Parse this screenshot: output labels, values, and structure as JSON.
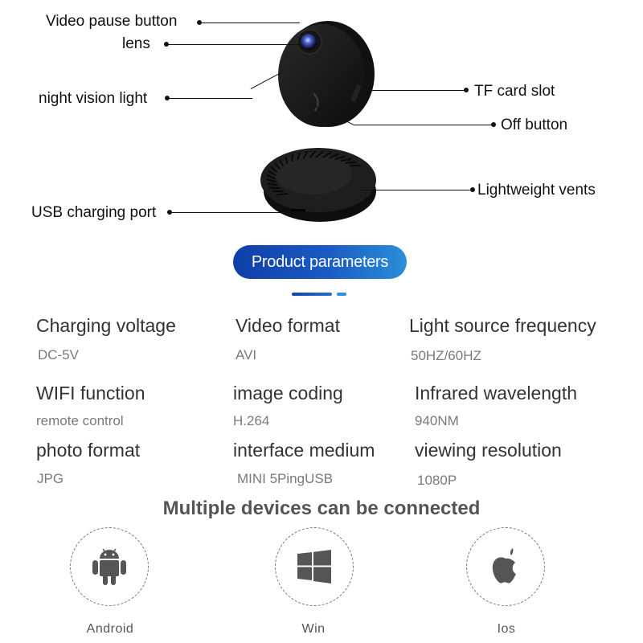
{
  "callouts": {
    "video_pause_button": "Video pause button",
    "lens": "lens",
    "night_vision_light": "night vision light",
    "tf_card_slot": "TF card slot",
    "off_button": "Off button",
    "lightweight_vents": "Lightweight vents",
    "usb_charging_port": "USB charging port"
  },
  "section_title": "Product parameters",
  "parameters": [
    {
      "label": "Charging voltage",
      "value": "DC-5V"
    },
    {
      "label": "Video format",
      "value": "AVI"
    },
    {
      "label": "Light source frequency",
      "value": "50HZ/60HZ"
    },
    {
      "label": "WIFI function",
      "value": "remote control"
    },
    {
      "label": "image coding",
      "value": "H.264"
    },
    {
      "label": "Infrared wavelength",
      "value": "940NM"
    },
    {
      "label": "photo format",
      "value": "JPG"
    },
    {
      "label": "interface medium",
      "value": "MINI 5PingUSB"
    },
    {
      "label": "viewing resolution",
      "value": "1080P"
    }
  ],
  "devices": {
    "title": "Multiple devices can be connected",
    "items": [
      {
        "label": "Android",
        "icon": "android-icon"
      },
      {
        "label": "Win",
        "icon": "windows-icon"
      },
      {
        "label": "Ios",
        "icon": "apple-icon"
      }
    ]
  },
  "colors": {
    "accent_dark": "#0f3ea8",
    "accent_light": "#2a8fd8",
    "text_label": "#333333",
    "text_value": "#7a7a7a"
  }
}
